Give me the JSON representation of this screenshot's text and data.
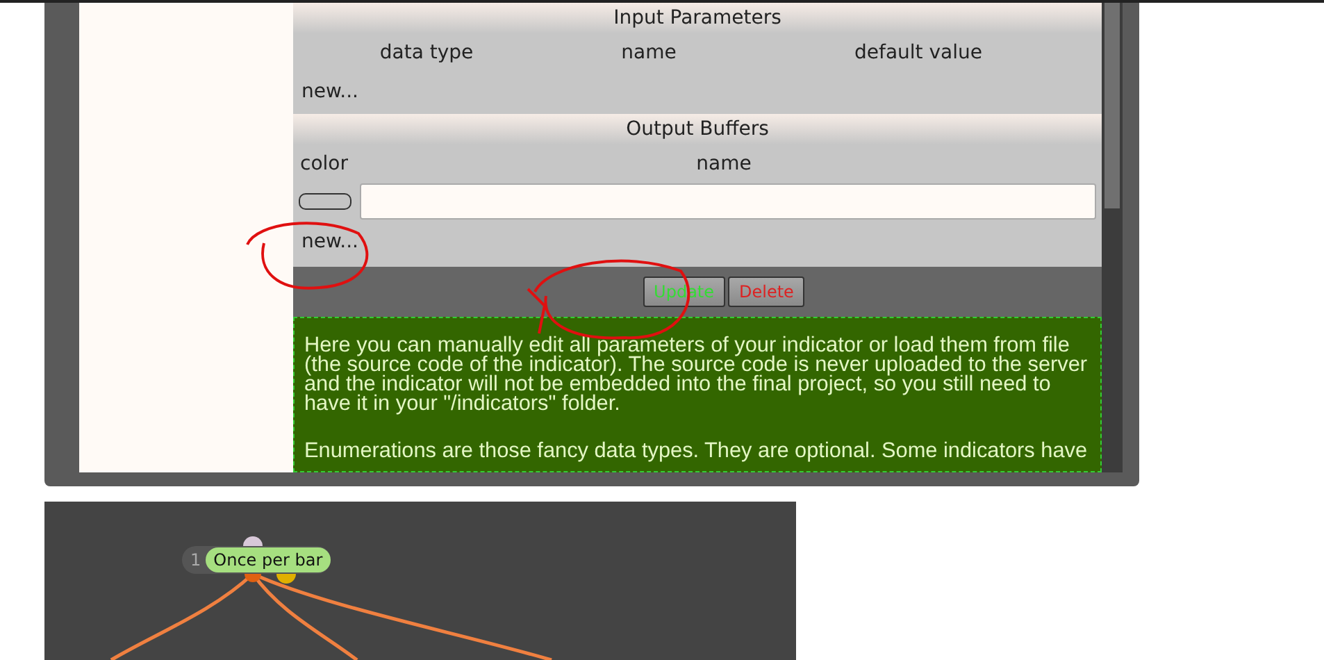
{
  "input_parameters": {
    "title": "Input Parameters",
    "columns": [
      "data type",
      "name",
      "default value"
    ],
    "new_link": "new..."
  },
  "output_buffers": {
    "title": "Output Buffers",
    "columns": [
      "color",
      "name"
    ],
    "buffers": [
      {
        "color": "#c4c4c4"
      }
    ],
    "new_link": "new..."
  },
  "buttons": [
    {
      "label": "Update",
      "kind": "update"
    },
    {
      "label": "Delete",
      "kind": "delete"
    }
  ],
  "help": [
    "Here you can manually edit all parameters of your indicator or load them from file (the source code of the indicator). The source code is never uploaded to the server and the indicator will not be embedded into the final project, so you still need to have it in your \"/indicators\" folder.",
    "Enumerations are those fancy data types. They are optional. Some indicators have"
  ],
  "graph": {
    "node": {
      "index": "1",
      "label": "Once per bar"
    }
  }
}
